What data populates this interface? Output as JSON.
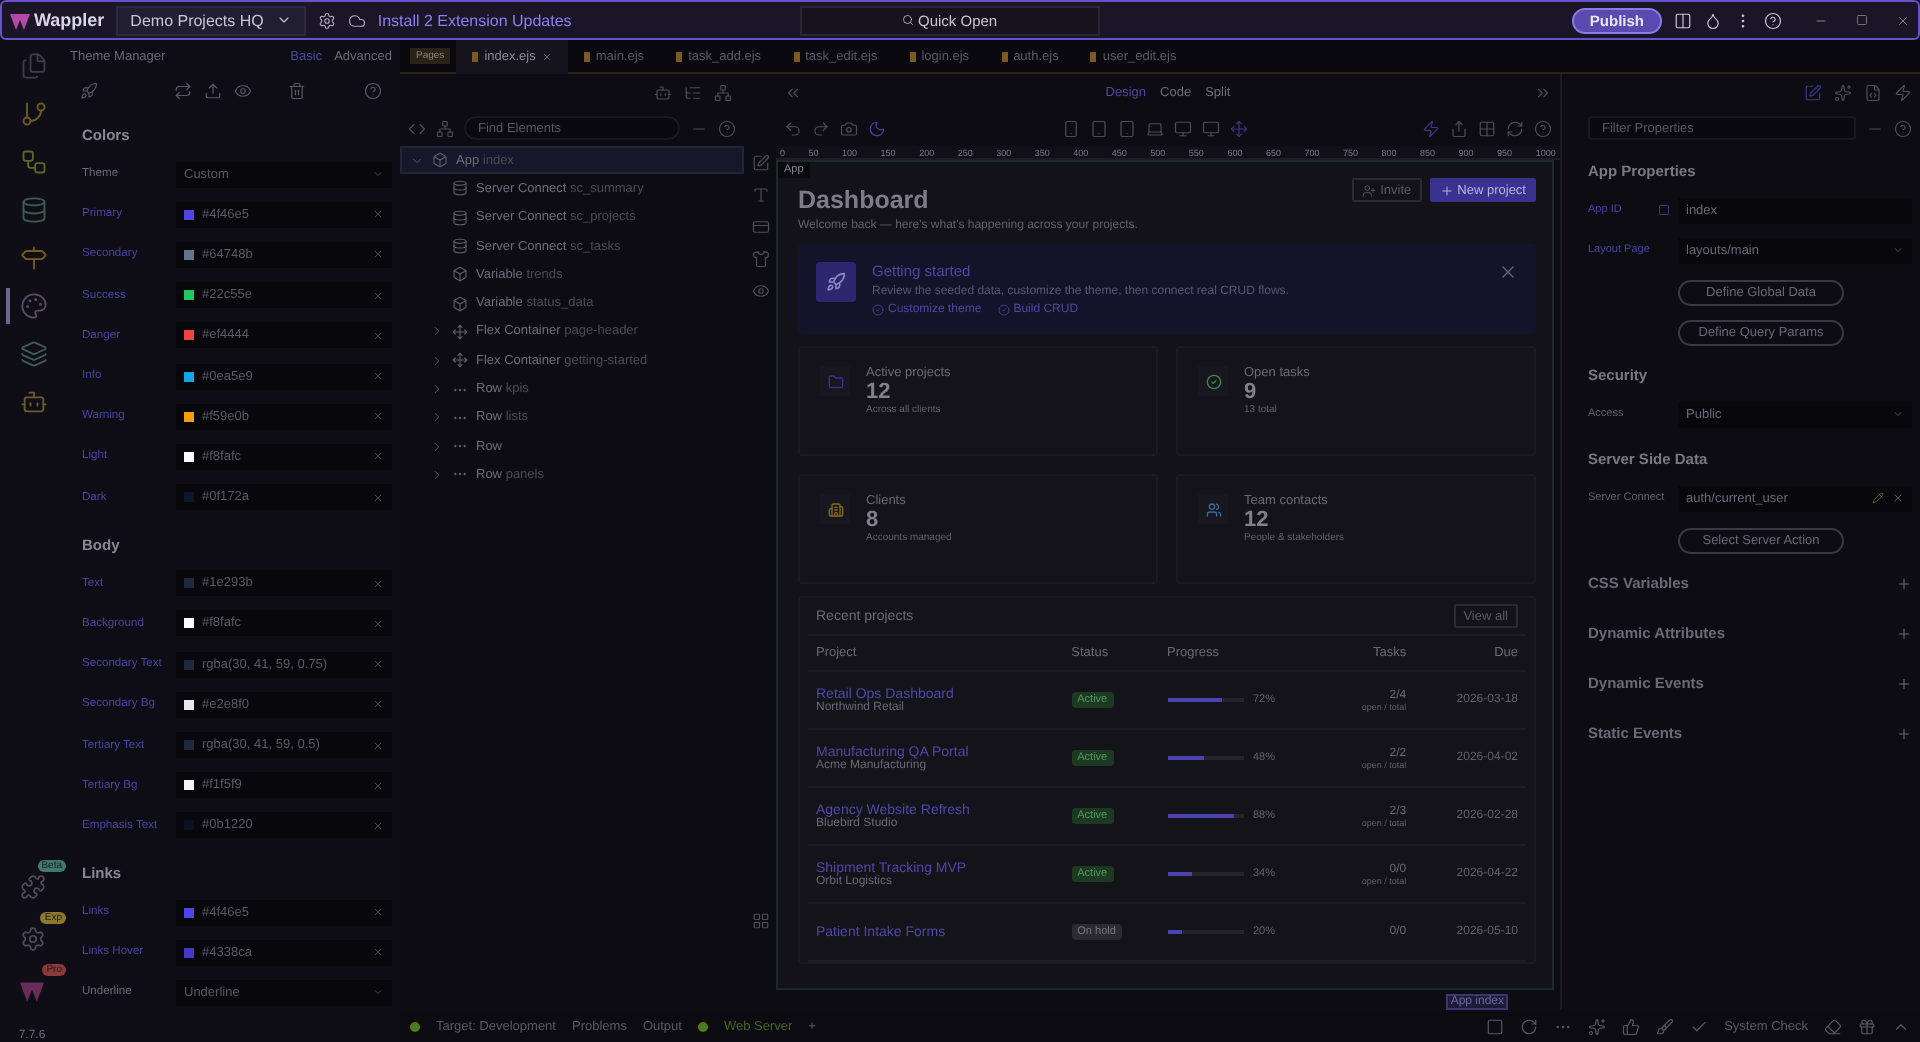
{
  "topbar": {
    "logo": "Wappler",
    "project": "Demo Projects HQ",
    "updates": "Install 2 Extension Updates",
    "quick_open": "Quick Open",
    "publish": "Publish"
  },
  "rail": {
    "items": [
      {
        "kind": "pages",
        "selected": false
      },
      {
        "kind": "git",
        "selected": false
      },
      {
        "kind": "flow",
        "selected": false
      },
      {
        "kind": "database",
        "selected": false
      },
      {
        "kind": "routes",
        "selected": false
      },
      {
        "kind": "theme",
        "selected": true
      },
      {
        "kind": "layers",
        "selected": false
      },
      {
        "kind": "robot",
        "selected": false
      }
    ],
    "extras": [
      {
        "kind": "puzzle",
        "badge": "Beta"
      },
      {
        "kind": "gear",
        "badge": "Exp"
      },
      {
        "kind": "logo",
        "badge": "Pro"
      }
    ],
    "version": "7.7.6"
  },
  "theme_manager": {
    "title": "Theme Manager",
    "modes": [
      {
        "label": "Basic",
        "selected": true
      },
      {
        "label": "Advanced",
        "selected": false
      }
    ],
    "sections": [
      {
        "title": "Colors",
        "rows": [
          {
            "kind": "select",
            "label": "Theme",
            "value": "Custom"
          },
          {
            "kind": "color",
            "label": "Primary",
            "value": "#4f46e5",
            "color": "#4f46e5"
          },
          {
            "kind": "color",
            "label": "Secondary",
            "value": "#64748b",
            "color": "#64748b"
          },
          {
            "kind": "color",
            "label": "Success",
            "value": "#22c55e",
            "color": "#22c55e"
          },
          {
            "kind": "color",
            "label": "Danger",
            "value": "#ef4444",
            "color": "#ef4444"
          },
          {
            "kind": "color",
            "label": "Info",
            "value": "#0ea5e9",
            "color": "#0ea5e9"
          },
          {
            "kind": "color",
            "label": "Warning",
            "value": "#f59e0b",
            "color": "#f59e0b"
          },
          {
            "kind": "color",
            "label": "Light",
            "value": "#f8fafc",
            "color": "#f8fafc"
          },
          {
            "kind": "color",
            "label": "Dark",
            "value": "#0f172a",
            "color": "#0f172a"
          }
        ]
      },
      {
        "title": "Body",
        "rows": [
          {
            "kind": "color",
            "label": "Text",
            "value": "#1e293b",
            "color": "#1e293b"
          },
          {
            "kind": "color",
            "label": "Background",
            "value": "#f8fafc",
            "color": "#f8fafc"
          },
          {
            "kind": "color",
            "label": "Secondary Text",
            "value": "rgba(30, 41, 59, 0.75)",
            "color": "#1e293b"
          },
          {
            "kind": "color",
            "label": "Secondary Bg",
            "value": "#e2e8f0",
            "color": "#e2e8f0"
          },
          {
            "kind": "color",
            "label": "Tertiary Text",
            "value": "rgba(30, 41, 59, 0.5)",
            "color": "#1e293b"
          },
          {
            "kind": "color",
            "label": "Tertiary Bg",
            "value": "#f1f5f9",
            "color": "#f1f5f9"
          },
          {
            "kind": "color",
            "label": "Emphasis Text",
            "value": "#0b1220",
            "color": "#0b1220"
          }
        ]
      },
      {
        "title": "Links",
        "rows": [
          {
            "kind": "color",
            "label": "Links",
            "value": "#4f46e5",
            "color": "#4f46e5"
          },
          {
            "kind": "color",
            "label": "Links Hover",
            "value": "#4338ca",
            "color": "#4338ca"
          },
          {
            "kind": "select",
            "label": "Underline",
            "value": "Underline"
          }
        ]
      }
    ]
  },
  "file_tabs": {
    "pages_label": "Pages",
    "tabs": [
      {
        "label": "index.ejs",
        "selected": true
      },
      {
        "label": "main.ejs",
        "selected": false
      },
      {
        "label": "task_add.ejs",
        "selected": false
      },
      {
        "label": "task_edit.ejs",
        "selected": false
      },
      {
        "label": "login.ejs",
        "selected": false
      },
      {
        "label": "auth.ejs",
        "selected": false
      },
      {
        "label": "user_edit.ejs",
        "selected": false
      }
    ]
  },
  "structure": {
    "search_placeholder": "Find Elements",
    "tree": [
      {
        "kind": "app",
        "type": "App",
        "name": "index",
        "expanded": true,
        "selected": true,
        "children": [
          {
            "kind": "server",
            "type": "Server Connect",
            "name": "sc_summary",
            "selected": false
          },
          {
            "kind": "server",
            "type": "Server Connect",
            "name": "sc_projects",
            "selected": false
          },
          {
            "kind": "server",
            "type": "Server Connect",
            "name": "sc_tasks",
            "selected": false
          },
          {
            "kind": "variable",
            "type": "Variable",
            "name": "trends",
            "selected": false
          },
          {
            "kind": "variable",
            "type": "Variable",
            "name": "status_data",
            "selected": false
          },
          {
            "kind": "flex",
            "type": "Flex Container",
            "name": "page-header",
            "expanded": false,
            "selected": false
          },
          {
            "kind": "flex",
            "type": "Flex Container",
            "name": "getting-started",
            "expanded": false,
            "selected": false
          },
          {
            "kind": "row",
            "type": "Row",
            "name": "kpis",
            "expanded": false,
            "selected": false
          },
          {
            "kind": "row",
            "type": "Row",
            "name": "lists",
            "expanded": false,
            "selected": false
          },
          {
            "kind": "row",
            "type": "Row",
            "expanded": false,
            "selected": false
          },
          {
            "kind": "row",
            "type": "Row",
            "name": "panels",
            "expanded": false,
            "selected": false
          }
        ]
      }
    ]
  },
  "canvas": {
    "view_modes": [
      {
        "label": "Design",
        "selected": true
      },
      {
        "label": "Code",
        "selected": false
      },
      {
        "label": "Split",
        "selected": false
      }
    ],
    "ruler": [
      "0",
      "50",
      "100",
      "150",
      "200",
      "250",
      "300",
      "350",
      "400",
      "450",
      "500",
      "550",
      "600",
      "650",
      "700",
      "750",
      "800",
      "850",
      "900",
      "950",
      "1000"
    ],
    "element_tag": "App",
    "title": "Dashboard",
    "subtitle": "Welcome back — here's what's happening across your projects.",
    "actions": [
      {
        "kind": "secondary",
        "label": "Invite"
      },
      {
        "kind": "primary",
        "label": "New project"
      }
    ],
    "banner": {
      "title": "Getting started",
      "text": "Review the seeded data, customize the theme, then connect real CRUD flows.",
      "checks": [
        "Customize theme",
        "Build CRUD"
      ]
    },
    "kpis": [
      {
        "kind": "projects",
        "label": "Active projects",
        "value": "12",
        "note": "Across all clients"
      },
      {
        "kind": "tasks",
        "label": "Open tasks",
        "value": "9",
        "note": "13 total"
      },
      {
        "kind": "clients",
        "label": "Clients",
        "value": "8",
        "note": "Accounts managed"
      },
      {
        "kind": "contacts",
        "label": "Team contacts",
        "value": "12",
        "note": "People & stakeholders"
      }
    ],
    "recent": {
      "title": "Recent projects",
      "action": "View all",
      "columns": [
        "Project",
        "Status",
        "Progress",
        "Tasks",
        "Due"
      ],
      "rows": [
        {
          "name": "Retail Ops Dashboard",
          "client": "Northwind Retail",
          "status": {
            "kind": "active",
            "label": "Active"
          },
          "level": 0.72,
          "percent": "72%",
          "tasks": "2/4",
          "tasks_note": "open / total",
          "due": "2026-03-18"
        },
        {
          "name": "Manufacturing QA Portal",
          "client": "Acme Manufacturing",
          "status": {
            "kind": "active",
            "label": "Active"
          },
          "level": 0.48,
          "percent": "48%",
          "tasks": "2/2",
          "tasks_note": "open / total",
          "due": "2026-04-02"
        },
        {
          "name": "Agency Website Refresh",
          "client": "Bluebird Studio",
          "status": {
            "kind": "active",
            "label": "Active"
          },
          "level": 0.88,
          "percent": "88%",
          "tasks": "2/3",
          "tasks_note": "open / total",
          "due": "2026-02-28"
        },
        {
          "name": "Shipment Tracking MVP",
          "client": "Orbit Logistics",
          "status": {
            "kind": "active",
            "label": "Active"
          },
          "level": 0.34,
          "percent": "34%",
          "tasks": "0/0",
          "tasks_note": "open / total",
          "due": "2026-04-22"
        },
        {
          "name": "Patient Intake Forms",
          "status": {
            "kind": "hold",
            "label": "On hold"
          },
          "level": 0.2,
          "percent": "20%",
          "tasks": "0/0",
          "due": "2026-05-10"
        }
      ]
    },
    "selection_label": "App index"
  },
  "properties": {
    "filter_placeholder": "Filter Properties",
    "sections": [
      {
        "title": "App Properties",
        "expanded": true,
        "fields": [
          {
            "kind": "input",
            "label": "App ID",
            "value": "index"
          },
          {
            "kind": "select",
            "label": "Layout Page",
            "value": "layouts/main"
          }
        ],
        "buttons": [
          "Define Global Data",
          "Define Query Params"
        ]
      },
      {
        "title": "Security",
        "expanded": true,
        "fields": [
          {
            "kind": "select",
            "label": "Access",
            "value": "Public"
          }
        ]
      },
      {
        "title": "Server Side Data",
        "expanded": true,
        "fields": [
          {
            "kind": "picker",
            "label": "Server Connect",
            "value": "auth/current_user"
          }
        ],
        "buttons": [
          "Select Server Action"
        ]
      },
      {
        "title": "CSS Variables",
        "expanded": false
      },
      {
        "title": "Dynamic Attributes",
        "expanded": false
      },
      {
        "title": "Dynamic Events",
        "expanded": false
      },
      {
        "title": "Static Events",
        "expanded": false
      }
    ]
  },
  "status_bar": {
    "target": "Target: Development",
    "problems": "Problems",
    "output": "Output",
    "web_server": "Web Server",
    "add": "+",
    "system_check": "System Check"
  }
}
